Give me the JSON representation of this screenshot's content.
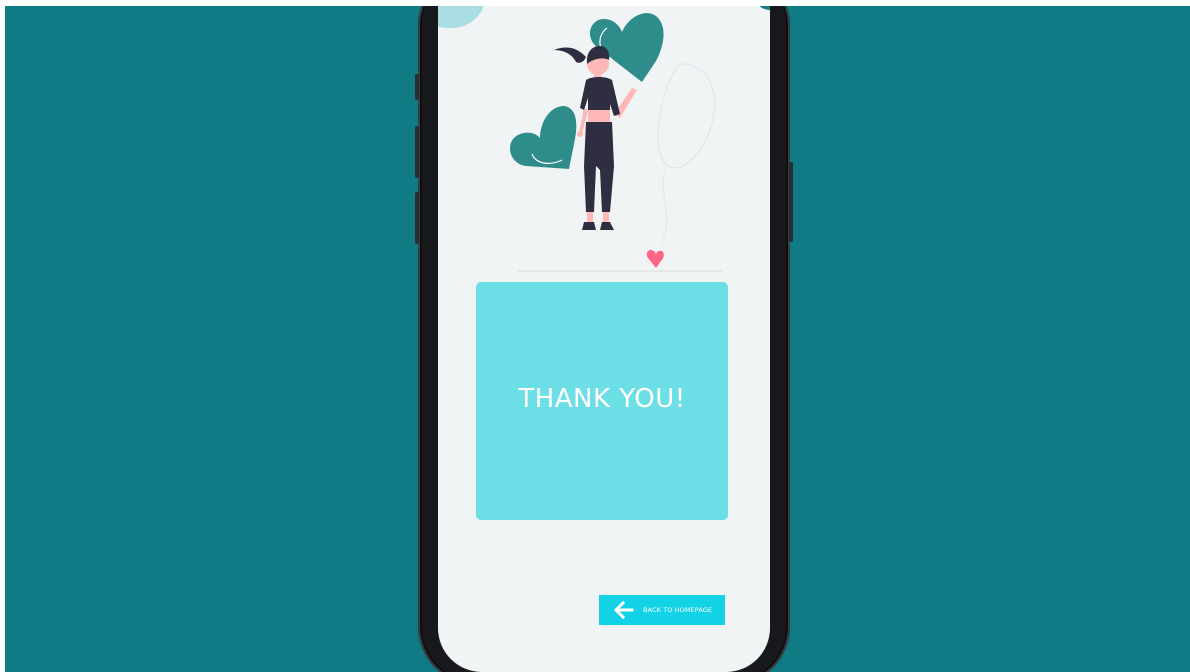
{
  "card": {
    "title": "THANK YOU!"
  },
  "back_button": {
    "label": "BACK TO HOMEPAGE",
    "icon": "arrow-left-icon"
  },
  "illustration": {
    "subject": "woman-with-hearts"
  },
  "colors": {
    "background": "#107b84",
    "screen": "#f1f4f5",
    "card": "#6cdee6",
    "button": "#13d2e6",
    "heart": "#2e8c8b",
    "small_heart": "#ff6584"
  }
}
